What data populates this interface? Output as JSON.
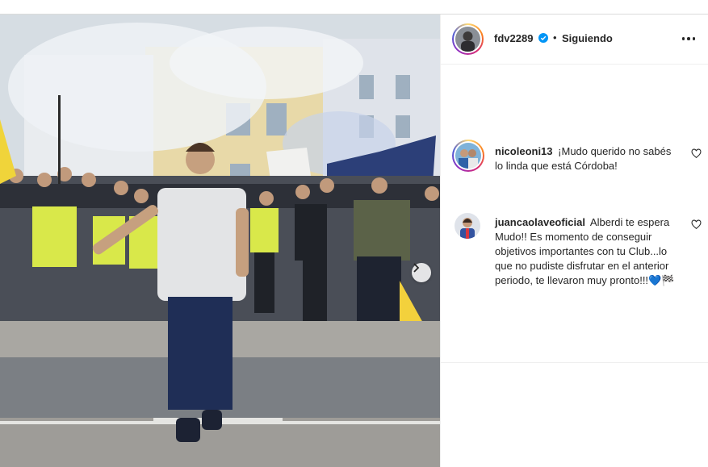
{
  "post": {
    "author": "fdv2289",
    "follow_status": "Siguiendo",
    "verified": true
  },
  "comments": [
    {
      "username": "nicoleoni13",
      "text": "¡Mudo querido no sabés lo linda que está Córdoba!"
    },
    {
      "username": "juancaolaveoficial",
      "text": "Alberdi te espera Mudo!! Es momento de conseguir objetivos importantes con tu Club...lo que no pudiste disfrutar en el anterior periodo, te llevaron muy pronto!!!💙🏁"
    }
  ],
  "icons": {
    "verified": "verified-badge-icon",
    "more": "more-options-icon",
    "heart": "heart-outline-icon",
    "next": "chevron-right-icon"
  },
  "colors": {
    "verified_blue": "#0095f6",
    "text": "#262626",
    "border": "#efefef"
  }
}
